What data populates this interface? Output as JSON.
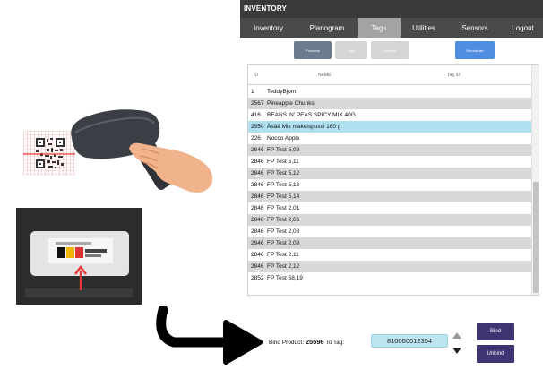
{
  "app": {
    "title": "INVENTORY",
    "nav": [
      {
        "label": "Inventory"
      },
      {
        "label": "Planogram"
      },
      {
        "label": "Tags",
        "active": true
      },
      {
        "label": "Utilities"
      },
      {
        "label": "Sensors"
      },
      {
        "label": "Logout"
      }
    ],
    "subtabs": {
      "products": "Products",
      "tags": "Tags",
      "stations": "Stations",
      "reload": "Reload tab"
    },
    "table": {
      "headers": {
        "id": "ID",
        "name": "NAME",
        "tag_id": "Tag ID"
      },
      "rows": [
        {
          "id": "1",
          "name": "TeddyBjorn",
          "style": "plain"
        },
        {
          "id": "2567",
          "name": "Pineapple Chunks",
          "style": "alt"
        },
        {
          "id": "416",
          "name": "BEANS 'N' PEAS SPICY MIX 40G",
          "style": "plain"
        },
        {
          "id": "2550",
          "name": "Äsää Mix makeispussi 160 g",
          "style": "sel"
        },
        {
          "id": "226",
          "name": "Nocco Apple",
          "style": "plain"
        },
        {
          "id": "2846",
          "name": "FP Test 5,09",
          "style": "alt"
        },
        {
          "id": "2846",
          "name": "FP Test 5,11",
          "style": "plain"
        },
        {
          "id": "2846",
          "name": "FP Test 5,12",
          "style": "alt"
        },
        {
          "id": "2846",
          "name": "FP Test 5,13",
          "style": "plain"
        },
        {
          "id": "2846",
          "name": "FP Test 5,14",
          "style": "alt"
        },
        {
          "id": "2846",
          "name": "FP Test 2,01",
          "style": "plain"
        },
        {
          "id": "2846",
          "name": "FP Test 2,06",
          "style": "alt"
        },
        {
          "id": "2846",
          "name": "FP Test 2,08",
          "style": "plain"
        },
        {
          "id": "2846",
          "name": "FP Test 2,09",
          "style": "alt"
        },
        {
          "id": "2846",
          "name": "FP Test 2,11",
          "style": "plain"
        },
        {
          "id": "2846",
          "name": "FP Test 2,12",
          "style": "alt"
        },
        {
          "id": "2852",
          "name": "FP Test 58,19",
          "style": "plain"
        }
      ]
    }
  },
  "bind": {
    "label_prefix": "Bind Product:",
    "product_id": "25596",
    "label_to": "To Tag:",
    "tag_value": "810000012354",
    "bind_label": "Bind",
    "unbind_label": "Unbind"
  },
  "colors": {
    "titlebar": "#3a3a3a",
    "navbar": "#4a4a4a",
    "nav_active": "#a3a3a3",
    "button": "#3d3472",
    "selected_row": "#aee0ef",
    "reload_button": "#4f8de0"
  },
  "icons": {
    "scanner": "barcode-scanner-icon",
    "qr": "qr-code-icon",
    "label": "shelf-label-photo",
    "arrow": "curved-arrow-icon"
  }
}
